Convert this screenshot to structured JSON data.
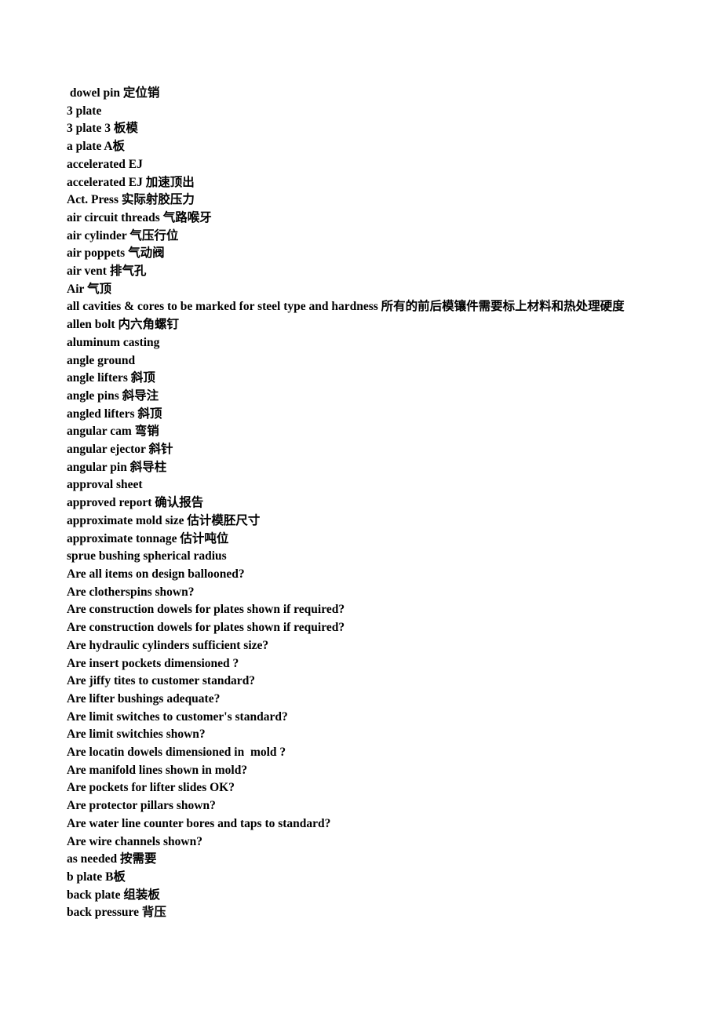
{
  "document": {
    "type": "glossary",
    "language_pair": "English-Chinese",
    "text_color": "#000000",
    "background_color": "#ffffff",
    "lines": [
      " dowel pin 定位销",
      "3 plate",
      "3 plate 3 板模",
      "a plate A板",
      "accelerated EJ",
      "accelerated EJ 加速顶出",
      "Act. Press 实际射胶压力",
      "air circuit threads 气路喉牙",
      "air cylinder 气压行位",
      "air poppets 气动阀",
      "air vent 排气孔",
      "Air 气顶",
      "all cavities & cores to be marked for steel type and hardness 所有的前后模镶件需要标上材料和热处理硬度",
      "allen bolt 内六角螺钉",
      "aluminum casting",
      "angle ground",
      "angle lifters 斜顶",
      "angle pins 斜导注",
      "angled lifters 斜顶",
      "angular cam 弯销",
      "angular ejector 斜针",
      "angular pin 斜导柱",
      "approval sheet",
      "approved report 确认报告",
      "approximate mold size 估计模胚尺寸",
      "approximate tonnage 估计吨位",
      "sprue bushing spherical radius",
      "Are all items on design ballooned?",
      "Are clotherspins shown?",
      "Are construction dowels for plates shown if required?",
      "Are construction dowels for plates shown if required?",
      "Are hydraulic cylinders sufficient size?",
      "Are insert pockets dimensioned ?",
      "Are jiffy tites to customer standard?",
      "Are lifter bushings adequate?",
      "Are limit switches to customer's standard?",
      "Are limit switchies shown?",
      "Are locatin dowels dimensioned in  mold ?",
      "Are manifold lines shown in mold?",
      "Are pockets for lifter slides OK?",
      "Are protector pillars shown?",
      "Are water line counter bores and taps to standard?",
      "Are wire channels shown?",
      "as needed 按需要",
      "b plate B板",
      "back plate 组装板",
      "back pressure 背压"
    ]
  }
}
